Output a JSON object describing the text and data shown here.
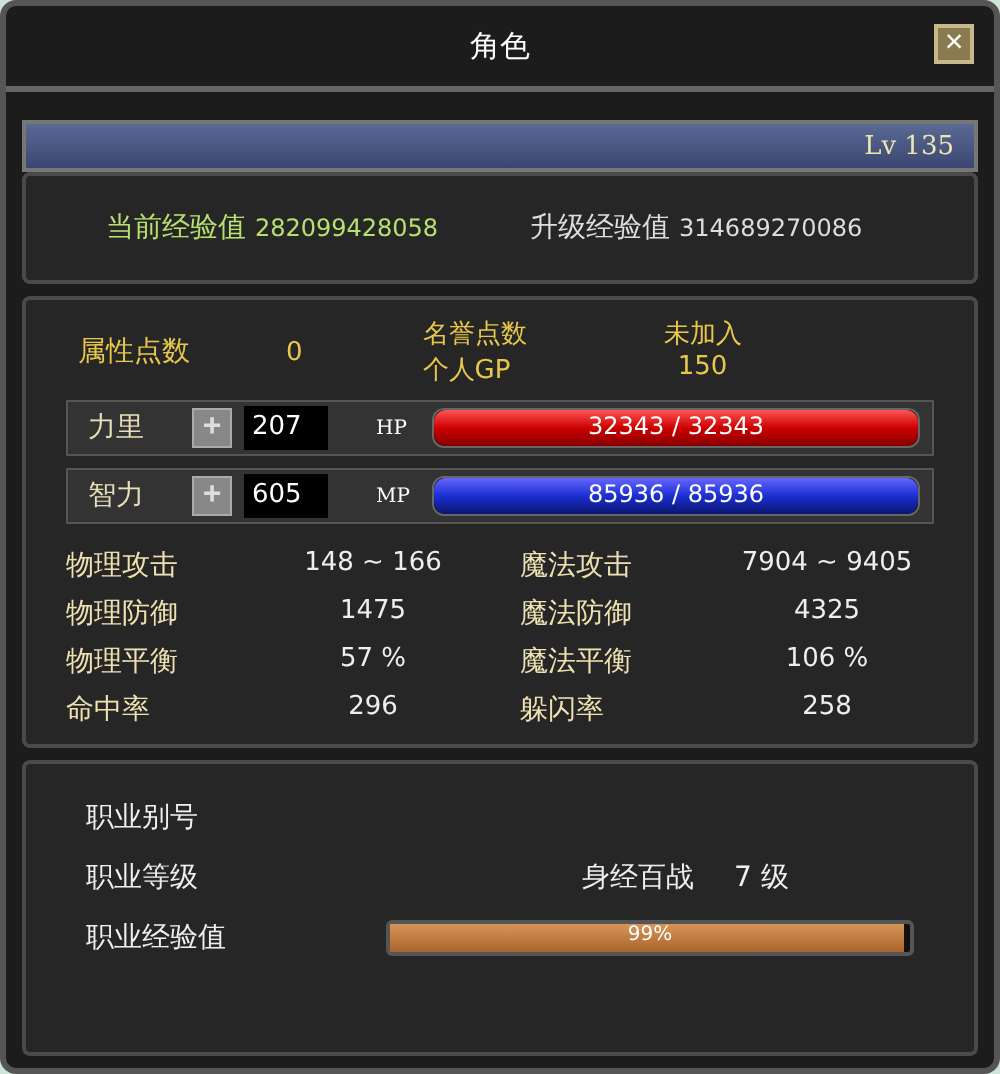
{
  "window": {
    "title": "角色",
    "close": "×"
  },
  "name_bar": {
    "level": "Lv 135"
  },
  "experience": [
    {
      "label": "当前经验值",
      "value": "282099428058",
      "kind": "current"
    },
    {
      "label": "升级经验值",
      "value": "314689270086",
      "kind": "next"
    }
  ],
  "points": {
    "label": "属性点数",
    "value": "0"
  },
  "honor": {
    "label": "名誉点数",
    "status": "未加入",
    "gp_label": "个人GP",
    "gp_value": "150"
  },
  "attributes": [
    {
      "label": "力里",
      "plus": "+",
      "value": "207",
      "bar_label": "HP",
      "reading": "32343 / 32343",
      "level": 1,
      "kind": "hp"
    },
    {
      "label": "智力",
      "plus": "+",
      "value": "605",
      "bar_label": "MP",
      "reading": "85936 / 85936",
      "level": 1,
      "kind": "mp"
    }
  ],
  "stats": [
    {
      "label": "物理攻击",
      "value": "148 ~ 166"
    },
    {
      "label": "魔法攻击",
      "value": "7904 ~ 9405"
    },
    {
      "label": "物理防御",
      "value": "1475"
    },
    {
      "label": "魔法防御",
      "value": "4325"
    },
    {
      "label": "物理平衡",
      "value": "57 %"
    },
    {
      "label": "魔法平衡",
      "value": "106 %"
    },
    {
      "label": "命中率",
      "value": "296"
    },
    {
      "label": "躲闪率",
      "value": "258"
    }
  ],
  "job": {
    "alias_label": "职业别号",
    "level_label": "职业等级",
    "rank": "身经百战",
    "rank_level": "7 级",
    "exp_label": "职业经验值",
    "exp_reading": "99%",
    "level": 0.99
  }
}
